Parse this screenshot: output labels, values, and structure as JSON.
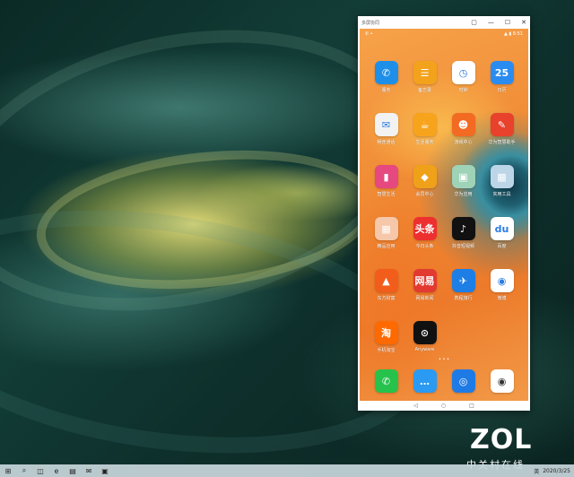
{
  "phone_window": {
    "title": "多屏协同",
    "controls": [
      "▢",
      "—",
      "☐",
      "✕"
    ],
    "status_left": "✆ •",
    "status_right": "▲ ▮ 8:51",
    "apps": [
      {
        "label": "服务",
        "icon": "service-icon",
        "color": "#1e8fe8",
        "glyph": "✆"
      },
      {
        "label": "备忘录",
        "icon": "memo-icon",
        "color": "#f3a21c",
        "glyph": "☰"
      },
      {
        "label": "时钟",
        "icon": "clock-icon",
        "color": "#ffffff",
        "glyph": "◷"
      },
      {
        "label": "日历",
        "icon": "calendar-icon",
        "color": "#2a8cf0",
        "glyph": "25"
      },
      {
        "label": "畅连通话",
        "icon": "mail-icon",
        "color": "#f2f2f2",
        "glyph": "✉"
      },
      {
        "label": "生活服务",
        "icon": "cup-icon",
        "color": "#f7a31c",
        "glyph": "☕"
      },
      {
        "label": "游戏中心",
        "icon": "gamepad-icon",
        "color": "#f36a23",
        "glyph": "☻"
      },
      {
        "label": "华为智慧助手",
        "icon": "assistant-icon",
        "color": "#e8412c",
        "glyph": "✎"
      },
      {
        "label": "智慧生活",
        "icon": "life-icon",
        "color": "#e64880",
        "glyph": "▮"
      },
      {
        "label": "会员中心",
        "icon": "diamond-icon",
        "color": "#f0a11a",
        "glyph": "◆"
      },
      {
        "label": "华为应用",
        "icon": "appstore-icon",
        "color": "#9fd3b8",
        "glyph": "▣"
      },
      {
        "label": "实用工具",
        "icon": "tools-folder-icon",
        "color": "#bcd6e8",
        "glyph": "▦"
      },
      {
        "label": "精品应用",
        "icon": "apps-folder-icon",
        "color": "#f6c7a8",
        "glyph": "▦"
      },
      {
        "label": "今日头条",
        "icon": "toutiao-icon",
        "color": "#ee2f2f",
        "glyph": "头条"
      },
      {
        "label": "抖音短视频",
        "icon": "douyin-icon",
        "color": "#111111",
        "glyph": "♪"
      },
      {
        "label": "百度",
        "icon": "baidu-icon",
        "color": "#ffffff",
        "glyph": "du"
      },
      {
        "label": "东方财富",
        "icon": "eastmoney-icon",
        "color": "#f25d1c",
        "glyph": "▲"
      },
      {
        "label": "网易新闻",
        "icon": "netease-icon",
        "color": "#e23a30",
        "glyph": "网易"
      },
      {
        "label": "携程旅行",
        "icon": "ctrip-icon",
        "color": "#1d7ee6",
        "glyph": "✈"
      },
      {
        "label": "微博",
        "icon": "weibo-icon",
        "color": "#ffffff",
        "glyph": "◉"
      },
      {
        "label": "手机淘宝",
        "icon": "taobao-icon",
        "color": "#ff6a00",
        "glyph": "淘"
      },
      {
        "label": "Anyware",
        "icon": "anyware-icon",
        "color": "#111111",
        "glyph": "⊙"
      }
    ],
    "page_dots": "• • •",
    "dock": [
      {
        "icon": "phone-icon",
        "color": "#27c24c",
        "glyph": "✆"
      },
      {
        "icon": "messages-icon",
        "color": "#2a9af3",
        "glyph": "…"
      },
      {
        "icon": "browser-icon",
        "color": "#1e7be6",
        "glyph": "◎"
      },
      {
        "icon": "camera-icon",
        "color": "#ffffff",
        "glyph": "◉"
      }
    ],
    "navbar": [
      "◁",
      "○",
      "□"
    ]
  },
  "taskbar": {
    "items": [
      {
        "icon": "start-icon",
        "glyph": "⊞"
      },
      {
        "icon": "search-icon",
        "glyph": "⌕"
      },
      {
        "icon": "task-view-icon",
        "glyph": "◫"
      },
      {
        "icon": "edge-icon",
        "glyph": "e"
      },
      {
        "icon": "folder-icon",
        "glyph": "▤"
      },
      {
        "icon": "mail-app-icon",
        "glyph": "✉"
      },
      {
        "icon": "app-icon",
        "glyph": "▣"
      }
    ],
    "tray_text": "英",
    "date": "2020/3/25"
  },
  "watermark": {
    "brand": "ZOL",
    "sub": "中关村在线"
  }
}
